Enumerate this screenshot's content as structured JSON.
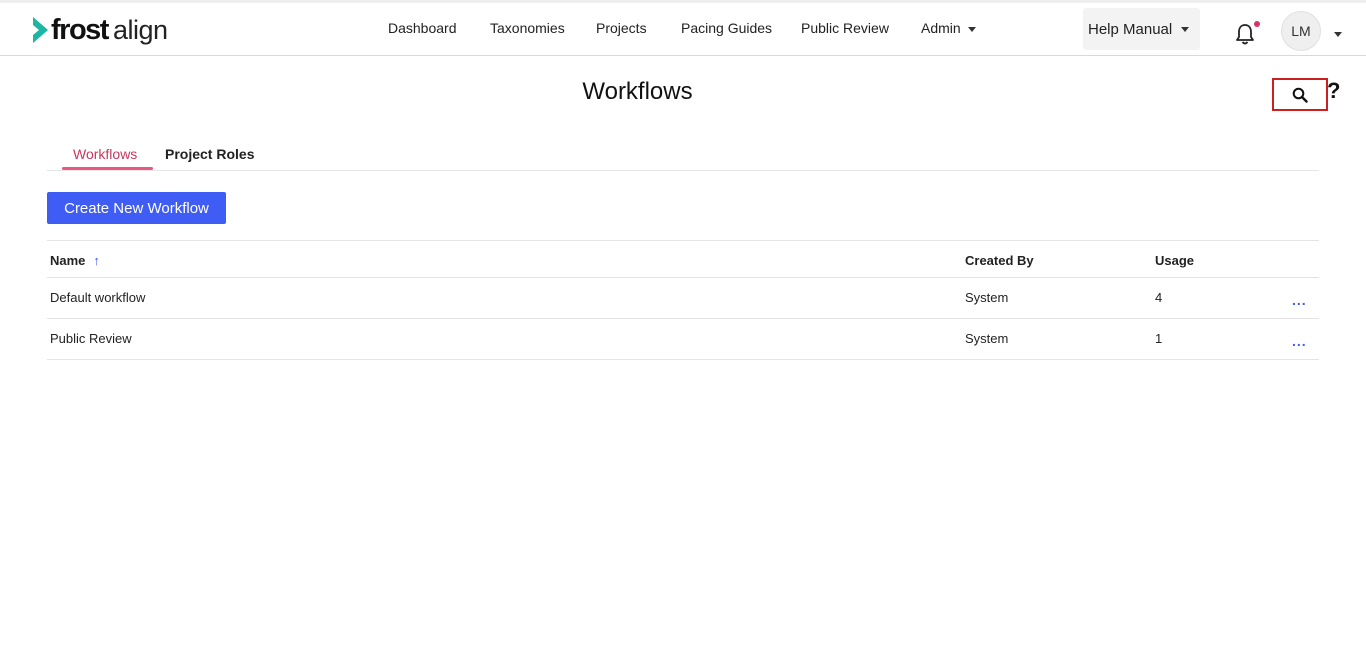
{
  "brand": {
    "name_bold": "frost",
    "name_light": "align",
    "accent_color": "#1db5a3"
  },
  "nav": {
    "items": [
      "Dashboard",
      "Taxonomies",
      "Projects",
      "Pacing Guides",
      "Public Review"
    ],
    "admin_label": "Admin",
    "help_label": "Help Manual",
    "avatar_initials": "LM"
  },
  "page": {
    "title": "Workflows"
  },
  "tabs": [
    {
      "label": "Workflows",
      "active": true
    },
    {
      "label": "Project Roles",
      "active": false
    }
  ],
  "create_button": "Create New Workflow",
  "table": {
    "headers": {
      "name": "Name",
      "created_by": "Created By",
      "usage": "Usage"
    },
    "sort_icon": "↑",
    "rows": [
      {
        "name": "Default workflow",
        "created_by": "System",
        "usage": "4",
        "actions": "..."
      },
      {
        "name": "Public Review",
        "created_by": "System",
        "usage": "1",
        "actions": "..."
      }
    ]
  },
  "icons": {
    "search": "search-icon",
    "help": "?",
    "notification": "bell-icon"
  },
  "colors": {
    "primary": "#3f5cf5",
    "active_tab": "#c9375e",
    "highlight_border": "#cc1f1f",
    "notification_dot": "#d6336c"
  }
}
